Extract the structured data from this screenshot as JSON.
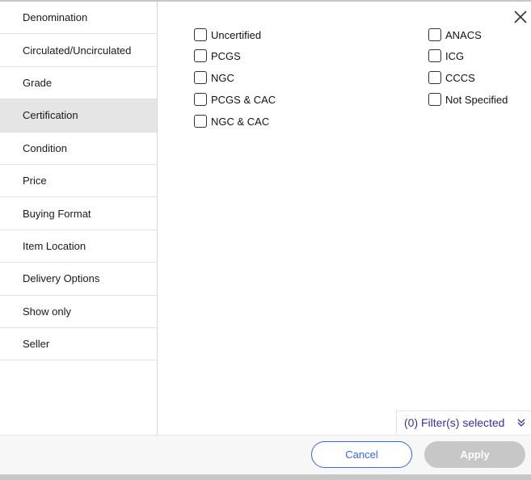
{
  "sidebar": {
    "items": [
      {
        "label": "Denomination"
      },
      {
        "label": "Circulated/Uncirculated"
      },
      {
        "label": "Grade"
      },
      {
        "label": "Certification"
      },
      {
        "label": "Condition"
      },
      {
        "label": "Price"
      },
      {
        "label": "Buying Format"
      },
      {
        "label": "Item Location"
      },
      {
        "label": "Delivery Options"
      },
      {
        "label": "Show only"
      },
      {
        "label": "Seller"
      }
    ],
    "active_item": "Certification"
  },
  "options": {
    "left": [
      {
        "label": "Uncertified",
        "checked": false
      },
      {
        "label": "PCGS",
        "checked": false
      },
      {
        "label": "NGC",
        "checked": false
      },
      {
        "label": "PCGS & CAC",
        "checked": false
      },
      {
        "label": "NGC & CAC",
        "checked": false
      }
    ],
    "right": [
      {
        "label": "ANACS",
        "checked": false
      },
      {
        "label": "ICG",
        "checked": false
      },
      {
        "label": "CCCS",
        "checked": false
      },
      {
        "label": "Not Specified",
        "checked": false
      }
    ]
  },
  "filter_status": {
    "label": "(0) Filter(s) selected"
  },
  "footer": {
    "cancel_label": "Cancel",
    "apply_label": "Apply"
  },
  "icons": {
    "close": "close-icon",
    "expand": "double-chevron-down-icon"
  },
  "colors": {
    "accent": "#3665f3",
    "filter_text": "#3a2ea6",
    "apply_disabled": "#c7c7c7",
    "active_bg": "#e5e5e5"
  }
}
